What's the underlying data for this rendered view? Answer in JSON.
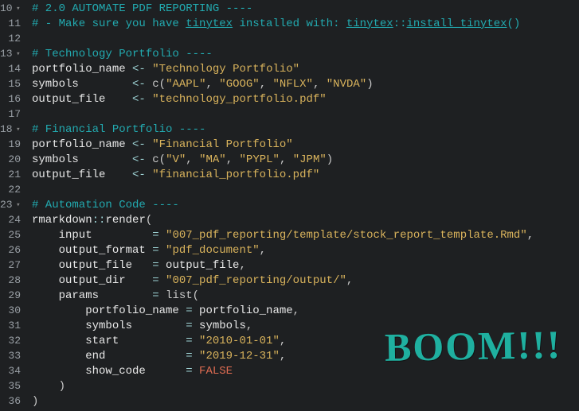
{
  "overlay_text": "BOOM!!!",
  "lines": [
    {
      "n": 10,
      "fold": true,
      "tokens": [
        {
          "t": "# 2.0 AUTOMATE PDF REPORTING ----",
          "c": "c-comment"
        }
      ]
    },
    {
      "n": 11,
      "tokens": [
        {
          "t": "# - Make sure you have ",
          "c": "c-comment"
        },
        {
          "t": "tinytex",
          "c": "c-comment c-under"
        },
        {
          "t": " installed with: ",
          "c": "c-comment"
        },
        {
          "t": "tinytex",
          "c": "c-comment c-under"
        },
        {
          "t": "::",
          "c": "c-comment"
        },
        {
          "t": "install_tinytex",
          "c": "c-comment c-under"
        },
        {
          "t": "()",
          "c": "c-comment"
        }
      ]
    },
    {
      "n": 12,
      "tokens": []
    },
    {
      "n": 13,
      "fold": true,
      "tokens": [
        {
          "t": "# Technology Portfolio ----",
          "c": "c-comment"
        }
      ]
    },
    {
      "n": 14,
      "tokens": [
        {
          "t": "portfolio_name ",
          "c": "c-ident"
        },
        {
          "t": "<- ",
          "c": "c-op"
        },
        {
          "t": "\"Technology Portfolio\"",
          "c": "c-string"
        }
      ]
    },
    {
      "n": 15,
      "tokens": [
        {
          "t": "symbols        ",
          "c": "c-ident"
        },
        {
          "t": "<- ",
          "c": "c-op"
        },
        {
          "t": "c(",
          "c": "c-paren"
        },
        {
          "t": "\"AAPL\"",
          "c": "c-string"
        },
        {
          "t": ", ",
          "c": "c-paren"
        },
        {
          "t": "\"GOOG\"",
          "c": "c-string"
        },
        {
          "t": ", ",
          "c": "c-paren"
        },
        {
          "t": "\"NFLX\"",
          "c": "c-string"
        },
        {
          "t": ", ",
          "c": "c-paren"
        },
        {
          "t": "\"NVDA\"",
          "c": "c-string"
        },
        {
          "t": ")",
          "c": "c-paren"
        }
      ]
    },
    {
      "n": 16,
      "tokens": [
        {
          "t": "output_file    ",
          "c": "c-ident"
        },
        {
          "t": "<- ",
          "c": "c-op"
        },
        {
          "t": "\"technology_portfolio.pdf\"",
          "c": "c-string"
        }
      ]
    },
    {
      "n": 17,
      "tokens": []
    },
    {
      "n": 18,
      "fold": true,
      "tokens": [
        {
          "t": "# Financial Portfolio ----",
          "c": "c-comment"
        }
      ]
    },
    {
      "n": 19,
      "tokens": [
        {
          "t": "portfolio_name ",
          "c": "c-ident"
        },
        {
          "t": "<- ",
          "c": "c-op"
        },
        {
          "t": "\"Financial Portfolio\"",
          "c": "c-string"
        }
      ]
    },
    {
      "n": 20,
      "tokens": [
        {
          "t": "symbols        ",
          "c": "c-ident"
        },
        {
          "t": "<- ",
          "c": "c-op"
        },
        {
          "t": "c(",
          "c": "c-paren"
        },
        {
          "t": "\"V\"",
          "c": "c-string"
        },
        {
          "t": ", ",
          "c": "c-paren"
        },
        {
          "t": "\"MA\"",
          "c": "c-string"
        },
        {
          "t": ", ",
          "c": "c-paren"
        },
        {
          "t": "\"PYPL\"",
          "c": "c-string"
        },
        {
          "t": ", ",
          "c": "c-paren"
        },
        {
          "t": "\"JPM\"",
          "c": "c-string"
        },
        {
          "t": ")",
          "c": "c-paren"
        }
      ]
    },
    {
      "n": 21,
      "tokens": [
        {
          "t": "output_file    ",
          "c": "c-ident"
        },
        {
          "t": "<- ",
          "c": "c-op"
        },
        {
          "t": "\"financial_portfolio.pdf\"",
          "c": "c-string"
        }
      ]
    },
    {
      "n": 22,
      "tokens": []
    },
    {
      "n": 23,
      "fold": true,
      "tokens": [
        {
          "t": "# Automation Code ----",
          "c": "c-comment"
        }
      ]
    },
    {
      "n": 24,
      "tokens": [
        {
          "t": "rmarkdown",
          "c": "c-ident"
        },
        {
          "t": "::",
          "c": "c-op"
        },
        {
          "t": "render",
          "c": "c-func"
        },
        {
          "t": "(",
          "c": "c-paren"
        }
      ]
    },
    {
      "n": 25,
      "tokens": [
        {
          "t": "    input         ",
          "c": "c-ident"
        },
        {
          "t": "= ",
          "c": "c-op"
        },
        {
          "t": "\"007_pdf_reporting/template/stock_report_template.Rmd\"",
          "c": "c-string"
        },
        {
          "t": ",",
          "c": "c-paren"
        }
      ]
    },
    {
      "n": 26,
      "tokens": [
        {
          "t": "    output_format ",
          "c": "c-ident"
        },
        {
          "t": "= ",
          "c": "c-op"
        },
        {
          "t": "\"pdf_document\"",
          "c": "c-string"
        },
        {
          "t": ",",
          "c": "c-paren"
        }
      ]
    },
    {
      "n": 27,
      "tokens": [
        {
          "t": "    output_file   ",
          "c": "c-ident"
        },
        {
          "t": "= ",
          "c": "c-op"
        },
        {
          "t": "output_file",
          "c": "c-ident"
        },
        {
          "t": ",",
          "c": "c-paren"
        }
      ]
    },
    {
      "n": 28,
      "tokens": [
        {
          "t": "    output_dir    ",
          "c": "c-ident"
        },
        {
          "t": "= ",
          "c": "c-op"
        },
        {
          "t": "\"007_pdf_reporting/output/\"",
          "c": "c-string"
        },
        {
          "t": ",",
          "c": "c-paren"
        }
      ]
    },
    {
      "n": 29,
      "tokens": [
        {
          "t": "    params        ",
          "c": "c-ident"
        },
        {
          "t": "= ",
          "c": "c-op"
        },
        {
          "t": "list(",
          "c": "c-paren"
        }
      ]
    },
    {
      "n": 30,
      "tokens": [
        {
          "t": "        portfolio_name ",
          "c": "c-ident"
        },
        {
          "t": "= ",
          "c": "c-op"
        },
        {
          "t": "portfolio_name",
          "c": "c-ident"
        },
        {
          "t": ",",
          "c": "c-paren"
        }
      ]
    },
    {
      "n": 31,
      "tokens": [
        {
          "t": "        symbols        ",
          "c": "c-ident"
        },
        {
          "t": "= ",
          "c": "c-op"
        },
        {
          "t": "symbols",
          "c": "c-ident"
        },
        {
          "t": ",",
          "c": "c-paren"
        }
      ]
    },
    {
      "n": 32,
      "tokens": [
        {
          "t": "        start          ",
          "c": "c-ident"
        },
        {
          "t": "= ",
          "c": "c-op"
        },
        {
          "t": "\"2010-01-01\"",
          "c": "c-string"
        },
        {
          "t": ",",
          "c": "c-paren"
        }
      ]
    },
    {
      "n": 33,
      "tokens": [
        {
          "t": "        end            ",
          "c": "c-ident"
        },
        {
          "t": "= ",
          "c": "c-op"
        },
        {
          "t": "\"2019-12-31\"",
          "c": "c-string"
        },
        {
          "t": ",",
          "c": "c-paren"
        }
      ]
    },
    {
      "n": 34,
      "tokens": [
        {
          "t": "        show_code      ",
          "c": "c-ident"
        },
        {
          "t": "= ",
          "c": "c-op"
        },
        {
          "t": "FALSE",
          "c": "c-bool"
        }
      ]
    },
    {
      "n": 35,
      "tokens": [
        {
          "t": "    )",
          "c": "c-paren"
        }
      ]
    },
    {
      "n": 36,
      "tokens": [
        {
          "t": ")",
          "c": "c-paren"
        }
      ]
    }
  ]
}
